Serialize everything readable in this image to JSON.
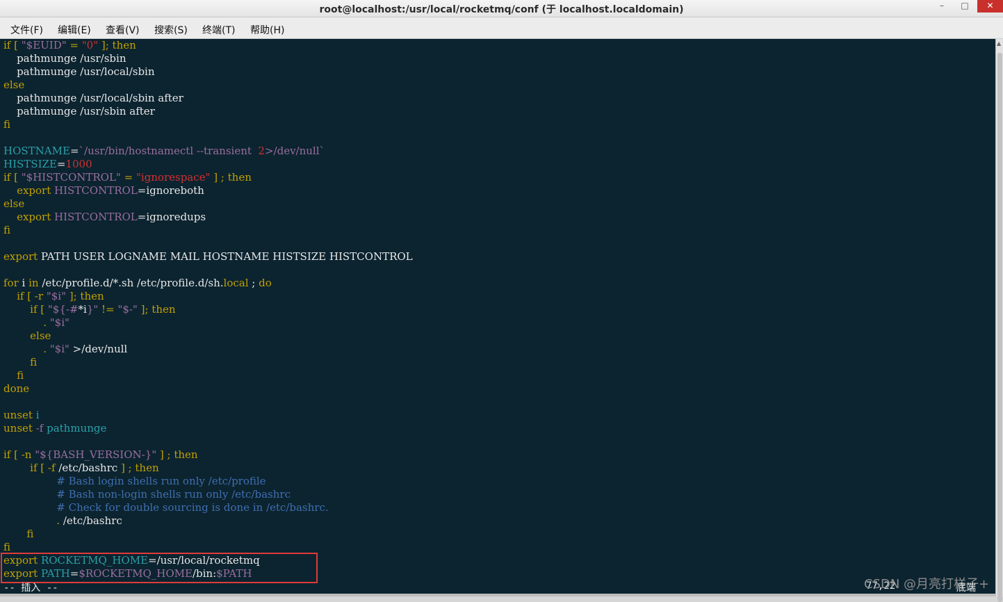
{
  "window": {
    "title": "root@localhost:/usr/local/rocketmq/conf (于 localhost.localdomain)",
    "minimize_glyph": "–",
    "maximize_glyph": "□",
    "close_glyph": "✕"
  },
  "menu": [
    "文件(F)",
    "编辑(E)",
    "查看(V)",
    "搜索(S)",
    "终端(T)",
    "帮助(H)"
  ],
  "editor": {
    "lines": [
      [
        [
          "k",
          "if [ "
        ],
        [
          "vp",
          "\"$EUID\""
        ],
        [
          "k",
          " = "
        ],
        [
          "s",
          "\"0\""
        ],
        [
          "k",
          " ]; then"
        ]
      ],
      [
        [
          "n",
          "    pathmunge /usr/sbin"
        ]
      ],
      [
        [
          "n",
          "    pathmunge /usr/local/sbin"
        ]
      ],
      [
        [
          "k",
          "else"
        ]
      ],
      [
        [
          "n",
          "    pathmunge /usr/local/sbin after"
        ]
      ],
      [
        [
          "n",
          "    pathmunge /usr/sbin after"
        ]
      ],
      [
        [
          "k",
          "fi"
        ]
      ],
      [
        [
          "n",
          ""
        ]
      ],
      [
        [
          "v",
          "HOSTNAME"
        ],
        [
          "n",
          "="
        ],
        [
          "vp",
          "`/usr/bin/hostnamectl --transient  "
        ],
        [
          "s",
          "2"
        ],
        [
          "vp",
          ">/dev/null`"
        ]
      ],
      [
        [
          "v",
          "HISTSIZE"
        ],
        [
          "n",
          "="
        ],
        [
          "s",
          "1000"
        ]
      ],
      [
        [
          "k",
          "if [ "
        ],
        [
          "vp",
          "\"$HISTCONTROL\""
        ],
        [
          "k",
          " = "
        ],
        [
          "s",
          "\"ignorespace\""
        ],
        [
          "k",
          " ] ; then"
        ]
      ],
      [
        [
          "k",
          "    export "
        ],
        [
          "vp",
          "HISTCONTROL"
        ],
        [
          "n",
          "=ignoreboth"
        ]
      ],
      [
        [
          "k",
          "else"
        ]
      ],
      [
        [
          "k",
          "    export "
        ],
        [
          "vp",
          "HISTCONTROL"
        ],
        [
          "n",
          "=ignoredups"
        ]
      ],
      [
        [
          "k",
          "fi"
        ]
      ],
      [
        [
          "n",
          ""
        ]
      ],
      [
        [
          "k",
          "export "
        ],
        [
          "n",
          "PATH USER LOGNAME MAIL HOSTNAME HISTSIZE HISTCONTROL"
        ]
      ],
      [
        [
          "n",
          ""
        ]
      ],
      [
        [
          "k",
          "for "
        ],
        [
          "n",
          "i "
        ],
        [
          "k",
          "in "
        ],
        [
          "n",
          "/etc/profile.d/*.sh /etc/profile.d/sh."
        ],
        [
          "k",
          "local"
        ],
        [
          "n",
          " ; "
        ],
        [
          "k",
          "do"
        ]
      ],
      [
        [
          "k",
          "    if [ -r "
        ],
        [
          "vp",
          "\"$i\""
        ],
        [
          "k",
          " ]; then"
        ]
      ],
      [
        [
          "k",
          "        if [ "
        ],
        [
          "vp",
          "\"${-#"
        ],
        [
          "n",
          "*i"
        ],
        [
          "vp",
          "}\""
        ],
        [
          "k",
          " != "
        ],
        [
          "vp",
          "\"$-\""
        ],
        [
          "k",
          " ]; then"
        ]
      ],
      [
        [
          "k",
          "            . "
        ],
        [
          "vp",
          "\"$i\""
        ]
      ],
      [
        [
          "k",
          "        else"
        ]
      ],
      [
        [
          "k",
          "            . "
        ],
        [
          "vp",
          "\"$i\""
        ],
        [
          "n",
          " >/dev/null"
        ]
      ],
      [
        [
          "k",
          "        fi"
        ]
      ],
      [
        [
          "k",
          "    fi"
        ]
      ],
      [
        [
          "k",
          "done"
        ]
      ],
      [
        [
          "n",
          ""
        ]
      ],
      [
        [
          "k",
          "unset "
        ],
        [
          "v",
          "i"
        ]
      ],
      [
        [
          "k",
          "unset "
        ],
        [
          "vp",
          "-f"
        ],
        [
          "v",
          " pathmunge"
        ]
      ],
      [
        [
          "n",
          ""
        ]
      ],
      [
        [
          "k",
          "if [ -n "
        ],
        [
          "vp",
          "\"${BASH_VERSION-}\""
        ],
        [
          "k",
          " ] ; then"
        ]
      ],
      [
        [
          "k",
          "        if [ -f "
        ],
        [
          "n",
          "/etc/bashrc"
        ],
        [
          "k",
          " ] ; then"
        ]
      ],
      [
        [
          "c",
          "                # Bash login shells run only /etc/profile"
        ]
      ],
      [
        [
          "c",
          "                # Bash non-login shells run only /etc/bashrc"
        ]
      ],
      [
        [
          "c",
          "                # Check for double sourcing is done in /etc/bashrc."
        ]
      ],
      [
        [
          "k",
          "                . "
        ],
        [
          "n",
          "/etc/bashrc"
        ]
      ],
      [
        [
          "k",
          "       fi"
        ]
      ],
      [
        [
          "k",
          "fi"
        ]
      ],
      [
        [
          "k",
          "export "
        ],
        [
          "v",
          "ROCKETMQ_HOME"
        ],
        [
          "n",
          "=/usr/local/rocketmq"
        ]
      ],
      [
        [
          "k",
          "export "
        ],
        [
          "v",
          "PATH"
        ],
        [
          "n",
          "="
        ],
        [
          "vp",
          "$ROCKETMQ_HOME"
        ],
        [
          "n",
          "/bin:"
        ],
        [
          "vp",
          "$PATH"
        ]
      ]
    ],
    "mode": "-- 插入 --",
    "cursor_position": "77,22",
    "scroll_position": "底端"
  },
  "watermark": "CSDN @月亮打样子+",
  "colors": {
    "background": "#0c2430",
    "keyword": "#c2a000",
    "variable": "#2aa0a8",
    "string": "#d33030",
    "comment": "#3f6fb0",
    "highlight_box": "#e03a3a"
  }
}
